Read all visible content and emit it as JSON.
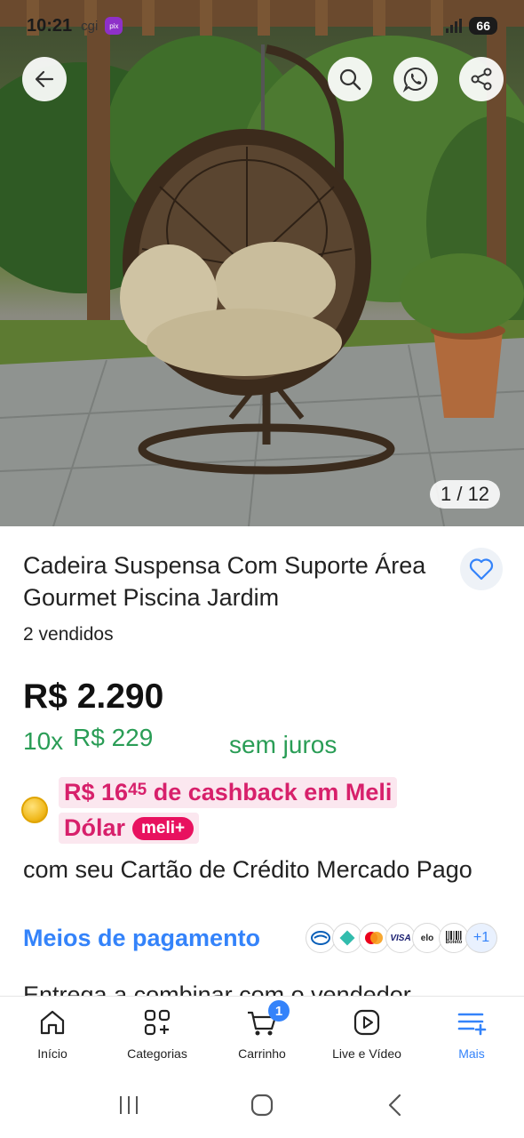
{
  "status_bar": {
    "time": "10:21",
    "carrier": "cgi",
    "pix_label": "pix",
    "battery": "66"
  },
  "header": {
    "back_icon": "arrow-left-icon",
    "search_icon": "search-icon",
    "whatsapp_icon": "whatsapp-icon",
    "share_icon": "share-icon"
  },
  "gallery": {
    "counter": "1 / 12"
  },
  "product": {
    "title": "Cadeira Suspensa Com Suporte Área Gourmet Piscina Jardim",
    "sold": "2 vendidos",
    "price": "R$ 2.290",
    "installments": {
      "count": "10x",
      "amount": "R$ 229",
      "note": "sem juros"
    },
    "cashback": {
      "prefix": "R$ 16",
      "cents": "45",
      "text": " de cashback em Meli",
      "line2": "Dólar",
      "badge": "meli+"
    },
    "cashback_note": "com seu Cartão de Crédito Mercado Pago",
    "payment_link": "Meios de pagamento",
    "payment_more": "+1",
    "payment_visa": "VISA",
    "payment_elo": "elo",
    "payment_boleto": "Boleto",
    "next_partial": "Entrega a combinar com o vendedor"
  },
  "tabbar": {
    "items": [
      {
        "label": "Início",
        "icon": "home-icon"
      },
      {
        "label": "Categorias",
        "icon": "categories-icon"
      },
      {
        "label": "Carrinho",
        "icon": "cart-icon",
        "badge": "1"
      },
      {
        "label": "Live e Vídeo",
        "icon": "video-icon"
      },
      {
        "label": "Mais",
        "icon": "menu-plus-icon"
      }
    ],
    "active_index": 4
  },
  "colors": {
    "accent": "#3483fa",
    "green": "#2a9d56",
    "cashback_pink": "#d7206b"
  }
}
